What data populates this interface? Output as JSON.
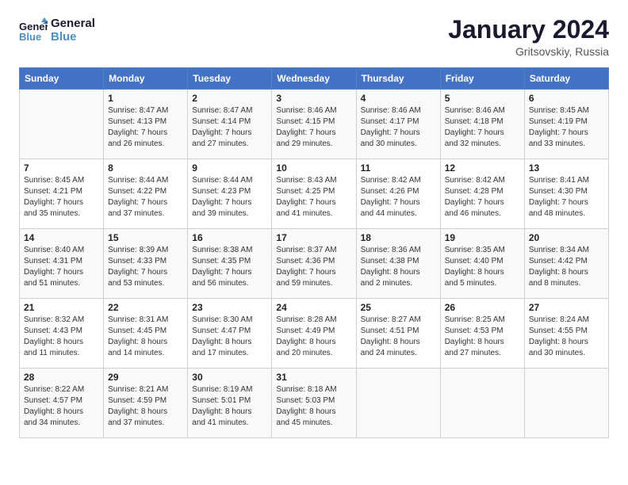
{
  "logo": {
    "line1": "General",
    "line2": "Blue"
  },
  "title": "January 2024",
  "location": "Gritsovskiy, Russia",
  "days_header": [
    "Sunday",
    "Monday",
    "Tuesday",
    "Wednesday",
    "Thursday",
    "Friday",
    "Saturday"
  ],
  "weeks": [
    [
      {
        "num": "",
        "info": ""
      },
      {
        "num": "1",
        "info": "Sunrise: 8:47 AM\nSunset: 4:13 PM\nDaylight: 7 hours\nand 26 minutes."
      },
      {
        "num": "2",
        "info": "Sunrise: 8:47 AM\nSunset: 4:14 PM\nDaylight: 7 hours\nand 27 minutes."
      },
      {
        "num": "3",
        "info": "Sunrise: 8:46 AM\nSunset: 4:15 PM\nDaylight: 7 hours\nand 29 minutes."
      },
      {
        "num": "4",
        "info": "Sunrise: 8:46 AM\nSunset: 4:17 PM\nDaylight: 7 hours\nand 30 minutes."
      },
      {
        "num": "5",
        "info": "Sunrise: 8:46 AM\nSunset: 4:18 PM\nDaylight: 7 hours\nand 32 minutes."
      },
      {
        "num": "6",
        "info": "Sunrise: 8:45 AM\nSunset: 4:19 PM\nDaylight: 7 hours\nand 33 minutes."
      }
    ],
    [
      {
        "num": "7",
        "info": "Sunrise: 8:45 AM\nSunset: 4:21 PM\nDaylight: 7 hours\nand 35 minutes."
      },
      {
        "num": "8",
        "info": "Sunrise: 8:44 AM\nSunset: 4:22 PM\nDaylight: 7 hours\nand 37 minutes."
      },
      {
        "num": "9",
        "info": "Sunrise: 8:44 AM\nSunset: 4:23 PM\nDaylight: 7 hours\nand 39 minutes."
      },
      {
        "num": "10",
        "info": "Sunrise: 8:43 AM\nSunset: 4:25 PM\nDaylight: 7 hours\nand 41 minutes."
      },
      {
        "num": "11",
        "info": "Sunrise: 8:42 AM\nSunset: 4:26 PM\nDaylight: 7 hours\nand 44 minutes."
      },
      {
        "num": "12",
        "info": "Sunrise: 8:42 AM\nSunset: 4:28 PM\nDaylight: 7 hours\nand 46 minutes."
      },
      {
        "num": "13",
        "info": "Sunrise: 8:41 AM\nSunset: 4:30 PM\nDaylight: 7 hours\nand 48 minutes."
      }
    ],
    [
      {
        "num": "14",
        "info": "Sunrise: 8:40 AM\nSunset: 4:31 PM\nDaylight: 7 hours\nand 51 minutes."
      },
      {
        "num": "15",
        "info": "Sunrise: 8:39 AM\nSunset: 4:33 PM\nDaylight: 7 hours\nand 53 minutes."
      },
      {
        "num": "16",
        "info": "Sunrise: 8:38 AM\nSunset: 4:35 PM\nDaylight: 7 hours\nand 56 minutes."
      },
      {
        "num": "17",
        "info": "Sunrise: 8:37 AM\nSunset: 4:36 PM\nDaylight: 7 hours\nand 59 minutes."
      },
      {
        "num": "18",
        "info": "Sunrise: 8:36 AM\nSunset: 4:38 PM\nDaylight: 8 hours\nand 2 minutes."
      },
      {
        "num": "19",
        "info": "Sunrise: 8:35 AM\nSunset: 4:40 PM\nDaylight: 8 hours\nand 5 minutes."
      },
      {
        "num": "20",
        "info": "Sunrise: 8:34 AM\nSunset: 4:42 PM\nDaylight: 8 hours\nand 8 minutes."
      }
    ],
    [
      {
        "num": "21",
        "info": "Sunrise: 8:32 AM\nSunset: 4:43 PM\nDaylight: 8 hours\nand 11 minutes."
      },
      {
        "num": "22",
        "info": "Sunrise: 8:31 AM\nSunset: 4:45 PM\nDaylight: 8 hours\nand 14 minutes."
      },
      {
        "num": "23",
        "info": "Sunrise: 8:30 AM\nSunset: 4:47 PM\nDaylight: 8 hours\nand 17 minutes."
      },
      {
        "num": "24",
        "info": "Sunrise: 8:28 AM\nSunset: 4:49 PM\nDaylight: 8 hours\nand 20 minutes."
      },
      {
        "num": "25",
        "info": "Sunrise: 8:27 AM\nSunset: 4:51 PM\nDaylight: 8 hours\nand 24 minutes."
      },
      {
        "num": "26",
        "info": "Sunrise: 8:25 AM\nSunset: 4:53 PM\nDaylight: 8 hours\nand 27 minutes."
      },
      {
        "num": "27",
        "info": "Sunrise: 8:24 AM\nSunset: 4:55 PM\nDaylight: 8 hours\nand 30 minutes."
      }
    ],
    [
      {
        "num": "28",
        "info": "Sunrise: 8:22 AM\nSunset: 4:57 PM\nDaylight: 8 hours\nand 34 minutes."
      },
      {
        "num": "29",
        "info": "Sunrise: 8:21 AM\nSunset: 4:59 PM\nDaylight: 8 hours\nand 37 minutes."
      },
      {
        "num": "30",
        "info": "Sunrise: 8:19 AM\nSunset: 5:01 PM\nDaylight: 8 hours\nand 41 minutes."
      },
      {
        "num": "31",
        "info": "Sunrise: 8:18 AM\nSunset: 5:03 PM\nDaylight: 8 hours\nand 45 minutes."
      },
      {
        "num": "",
        "info": ""
      },
      {
        "num": "",
        "info": ""
      },
      {
        "num": "",
        "info": ""
      }
    ]
  ]
}
